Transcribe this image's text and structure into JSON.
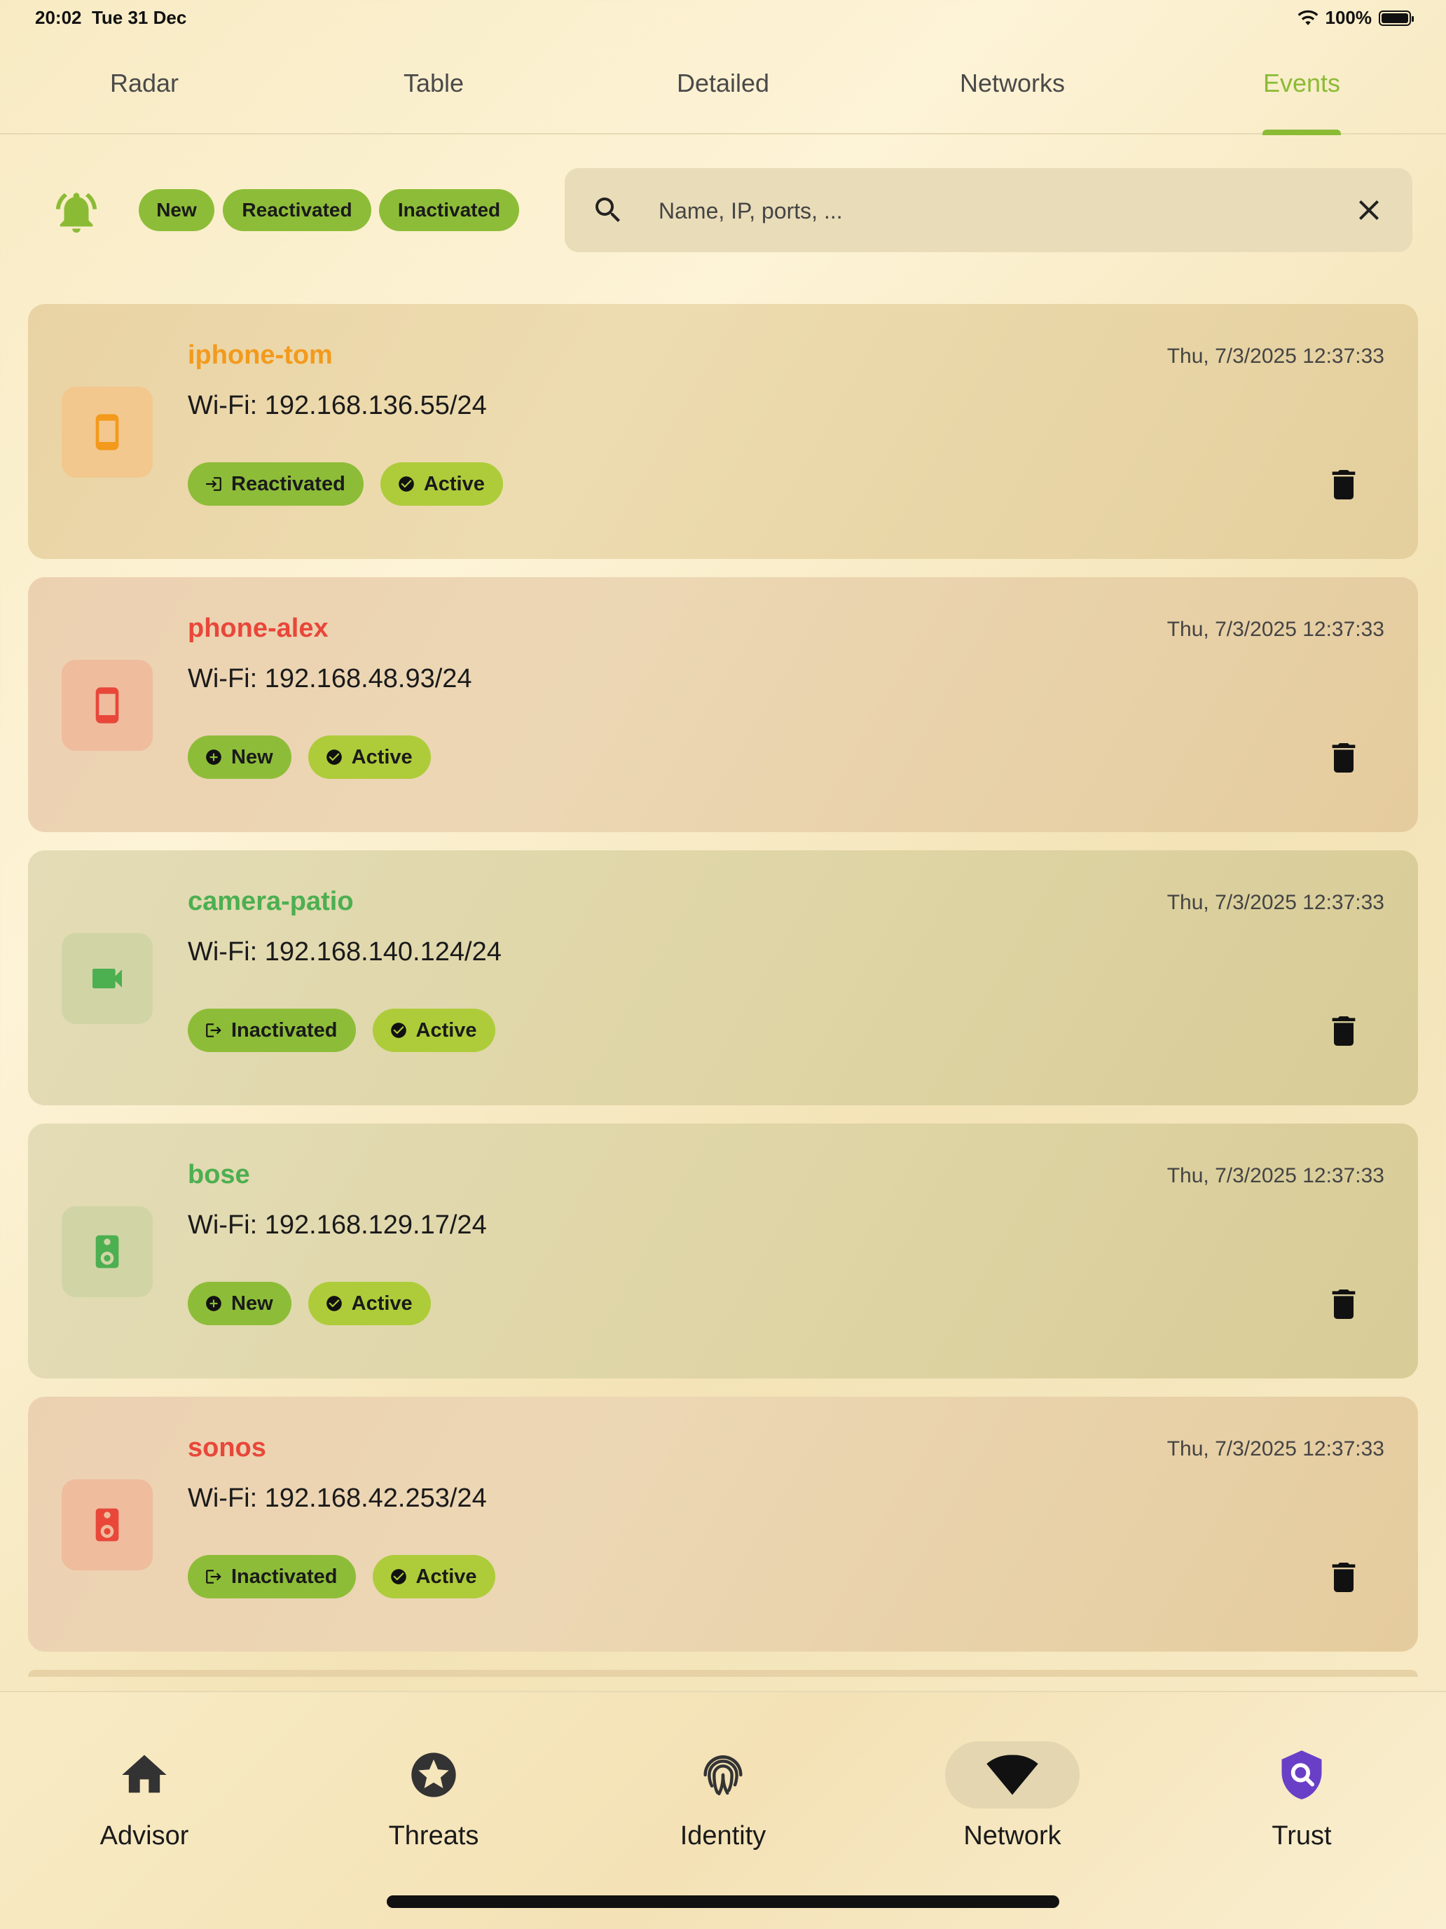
{
  "status_bar": {
    "time": "20:02",
    "date": "Tue 31 Dec",
    "battery": "100%"
  },
  "tabs": [
    {
      "label": "Radar",
      "active": false
    },
    {
      "label": "Table",
      "active": false
    },
    {
      "label": "Detailed",
      "active": false
    },
    {
      "label": "Networks",
      "active": false
    },
    {
      "label": "Events",
      "active": true
    }
  ],
  "filters": {
    "chips": [
      "New",
      "Reactivated",
      "Inactivated"
    ],
    "search_placeholder": "Name, IP, ports, ..."
  },
  "events": [
    {
      "name": "iphone-tom",
      "time": "Thu, 7/3/2025 12:37:33",
      "ip": "Wi-Fi: 192.168.136.55/24",
      "color": "orange",
      "device_icon": "phone-icon",
      "event": "Reactivated",
      "event_icon": "login-icon",
      "state": "Active"
    },
    {
      "name": "phone-alex",
      "time": "Thu, 7/3/2025 12:37:33",
      "ip": "Wi-Fi: 192.168.48.93/24",
      "color": "red",
      "device_icon": "phone-icon",
      "event": "New",
      "event_icon": "add-circle-icon",
      "state": "Active"
    },
    {
      "name": "camera-patio",
      "time": "Thu, 7/3/2025 12:37:33",
      "ip": "Wi-Fi: 192.168.140.124/24",
      "color": "green",
      "device_icon": "camera-icon",
      "event": "Inactivated",
      "event_icon": "logout-icon",
      "state": "Active"
    },
    {
      "name": "bose",
      "time": "Thu, 7/3/2025 12:37:33",
      "ip": "Wi-Fi: 192.168.129.17/24",
      "color": "green",
      "device_icon": "speaker-icon",
      "event": "New",
      "event_icon": "add-circle-icon",
      "state": "Active"
    },
    {
      "name": "sonos",
      "time": "Thu, 7/3/2025 12:37:33",
      "ip": "Wi-Fi: 192.168.42.253/24",
      "color": "red",
      "device_icon": "speaker-icon",
      "event": "Inactivated",
      "event_icon": "logout-icon",
      "state": "Active"
    }
  ],
  "bottom_nav": [
    {
      "label": "Advisor",
      "icon": "home-icon",
      "selected": false
    },
    {
      "label": "Threats",
      "icon": "star-circle-icon",
      "selected": false
    },
    {
      "label": "Identity",
      "icon": "fingerprint-icon",
      "selected": false
    },
    {
      "label": "Network",
      "icon": "wifi-icon",
      "selected": true
    },
    {
      "label": "Trust",
      "icon": "shield-search-icon",
      "selected": false
    }
  ],
  "colors": {
    "accent": "#8bbb35",
    "orange": "#f39a1c",
    "red": "#e8473a",
    "green": "#4caf50",
    "trust_purple": "#6a3fc7"
  }
}
